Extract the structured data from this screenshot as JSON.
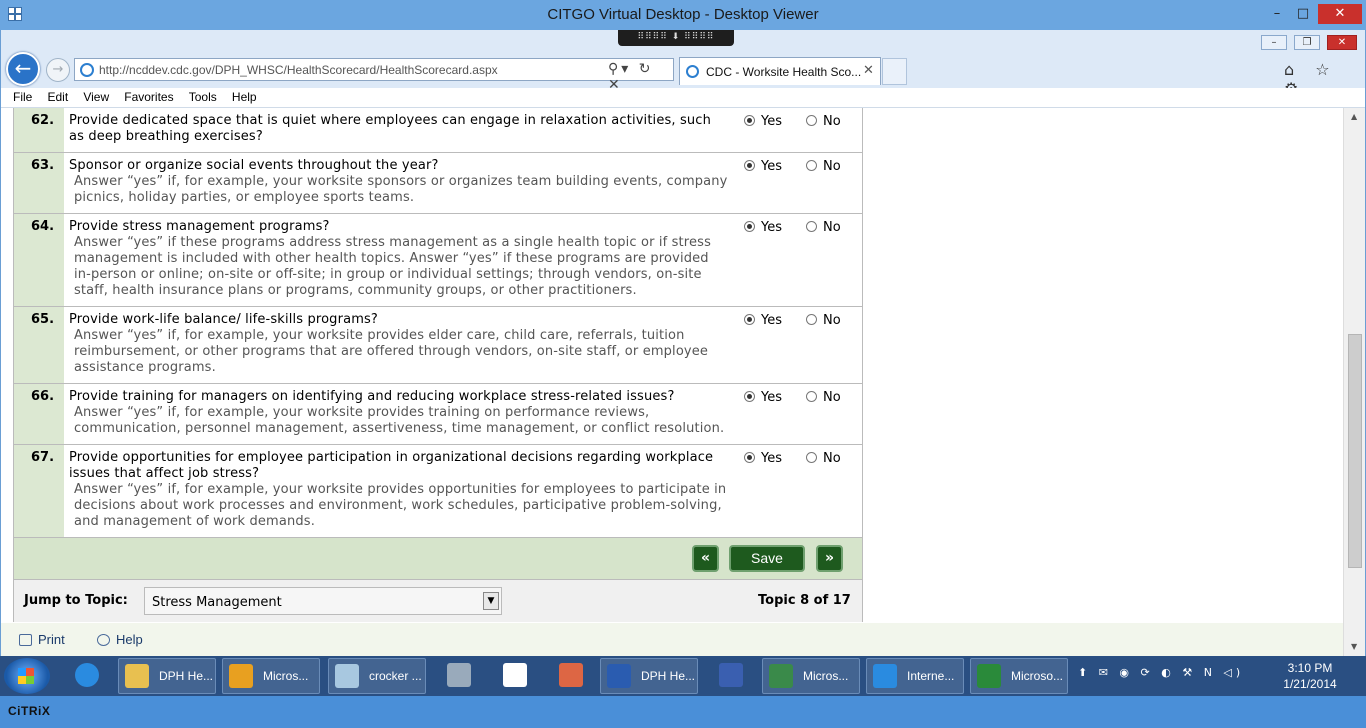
{
  "outer_window": {
    "title": "CITGO Virtual Desktop - Desktop Viewer",
    "min": "–",
    "max": "□",
    "close": "✕",
    "toolbar_handle": "⠿⠿⠿⠿ ⬇ ⠿⠿⠿⠿"
  },
  "browser": {
    "url": "http://ncddev.cdc.gov/DPH_WHSC/HealthScorecard/HealthScorecard.aspx",
    "address_controls": "⚲▾ ↻ ✕",
    "tab_title": "CDC - Worksite Health Sco...",
    "tab_close": "✕",
    "nav_icons": "⌂ ☆ ⚙",
    "back": "←",
    "forward": "→",
    "win_min": "–",
    "win_max": "❐",
    "win_close": "✕",
    "menu": [
      "File",
      "Edit",
      "View",
      "Favorites",
      "Tools",
      "Help"
    ]
  },
  "questions": [
    {
      "num": "62.",
      "text": "Provide dedicated space that is quiet where employees can engage in relaxation activities, such as deep breathing exercises?",
      "hint": "",
      "answer": "Yes"
    },
    {
      "num": "63.",
      "text": "Sponsor or organize social events throughout the year?",
      "hint": "Answer “yes” if, for example, your worksite sponsors or organizes team building events, company picnics, holiday parties, or employee sports teams.",
      "answer": "Yes"
    },
    {
      "num": "64.",
      "text": "Provide stress management programs?",
      "hint": "Answer “yes” if these programs address stress management as a single health topic or if stress management is included with other health topics. Answer “yes” if these programs are provided in-person or online; on-site or off-site; in group or individual settings; through vendors, on-site staff, health insurance plans or programs, community groups, or other practitioners.",
      "answer": "Yes"
    },
    {
      "num": "65.",
      "text": "Provide work-life balance/ life-skills programs?",
      "hint": "Answer “yes” if, for example, your worksite provides elder care, child care, referrals, tuition reimbursement, or other programs that are offered through vendors, on-site staff, or employee assistance programs.",
      "answer": "Yes"
    },
    {
      "num": "66.",
      "text": "Provide training for managers on identifying and reducing workplace stress-related issues?",
      "hint": "Answer “yes” if, for example, your worksite provides training on performance reviews, communication, personnel management, assertiveness, time management, or conflict resolution.",
      "answer": "Yes"
    },
    {
      "num": "67.",
      "text": "Provide opportunities for employee participation in organizational decisions regarding workplace issues that affect job stress?",
      "hint": "Answer “yes” if, for example, your worksite provides opportunities for employees to participate in decisions about work processes and environment, work schedules, participative problem-solving, and management of work demands.",
      "answer": "Yes"
    }
  ],
  "options": {
    "yes": "Yes",
    "no": "No"
  },
  "nav": {
    "prev": "«",
    "save": "Save",
    "next": "»"
  },
  "jump": {
    "label": "Jump to Topic:",
    "selected": "Stress Management",
    "arrow": "▼",
    "topic_count": "Topic 8 of 17"
  },
  "footer": {
    "print": "Print",
    "help": "Help"
  },
  "taskbar": {
    "buttons": [
      {
        "label": "DPH He...",
        "icon": "folder-icon"
      },
      {
        "label": "Micros...",
        "icon": "outlook-icon"
      },
      {
        "label": "crocker ...",
        "icon": "notepad-icon"
      },
      {
        "label": "DPH He...",
        "icon": "word-icon"
      },
      {
        "label": "Micros...",
        "icon": "lync-icon"
      },
      {
        "label": "Interne...",
        "icon": "ie-icon"
      },
      {
        "label": "Microso...",
        "icon": "excel-icon"
      }
    ],
    "tray": "⬆ ✉ ◉ ⟳ ◐ ⚒ N ◁)",
    "time": "3:10 PM",
    "date": "1/21/2014"
  },
  "citrix_logo": "CiTRiX",
  "colors": {
    "accent_green": "#1e5a1e",
    "row_num_bg": "#dce8d2",
    "title_blue": "#6ba6e0"
  }
}
